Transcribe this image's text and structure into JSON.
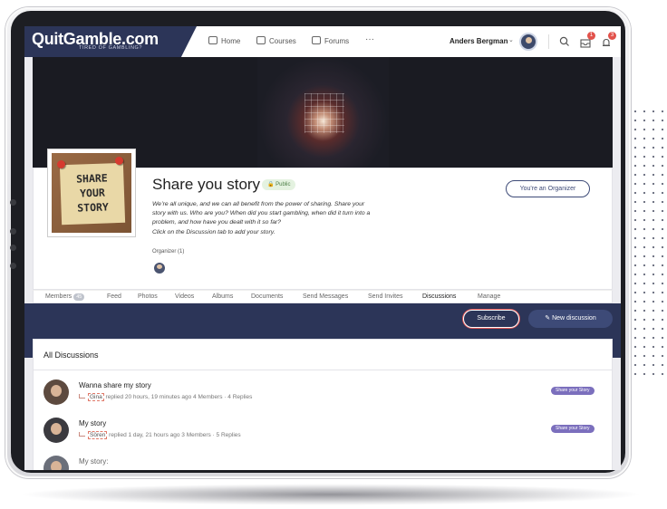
{
  "brand": {
    "name": "QuitGamble.com",
    "tagline": "TIRED OF GAMBLING?"
  },
  "nav": {
    "home": "Home",
    "courses": "Courses",
    "forums": "Forums",
    "more": "···"
  },
  "user": {
    "name": "Anders Bergman",
    "caret": "⌄",
    "messages_count": "1",
    "notifications_count": "3"
  },
  "group": {
    "thumb_text": [
      "SHARE",
      "YOUR",
      "STORY"
    ],
    "title": "Share you story",
    "privacy": "Public",
    "description": [
      "We’re all unique, and we can all benefit from the power of sharing. Share your",
      "story with us. Who are you? When did you start gambling, when did it turn into a",
      "problem, and how have you dealt with it so far?",
      "Click on the Discussion tab to add your story."
    ],
    "organizer_label": "Organizer (1)",
    "organizer_button": "You're an Organizer"
  },
  "tabs": [
    {
      "label": "Members",
      "count": "45"
    },
    {
      "label": "Feed"
    },
    {
      "label": "Photos"
    },
    {
      "label": "Videos"
    },
    {
      "label": "Albums"
    },
    {
      "label": "Documents"
    },
    {
      "label": "Send Messages"
    },
    {
      "label": "Send Invites"
    },
    {
      "label": "Discussions",
      "active": true
    },
    {
      "label": "Manage"
    }
  ],
  "actions": {
    "subscribe": "Subscribe",
    "new_discussion": "New discussion"
  },
  "discussions": {
    "heading": "All Discussions",
    "items": [
      {
        "title": "Wanna share my story",
        "user": "Gina",
        "meta": "replied 20 hours, 19 minutes ago   4 Members · 4 Replies",
        "tag": "Share your Story"
      },
      {
        "title": "My story",
        "user": "Sören",
        "meta": "replied 1 day, 21 hours ago   3 Members · 5 Replies",
        "tag": "Share your Story"
      },
      {
        "title": "My story:"
      }
    ]
  },
  "colors": {
    "navy": "#2c3558",
    "accent": "#3d4a77",
    "tag": "#7b6fbd",
    "badge": "#e2524b"
  }
}
